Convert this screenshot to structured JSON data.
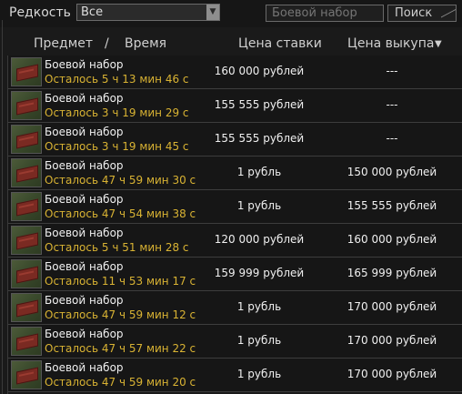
{
  "filter": {
    "rarity_label": "Редкость",
    "rarity_selected": "Все",
    "search_placeholder": "Боевой набор",
    "search_button_label": "Поиск"
  },
  "columns": {
    "item": "Предмет",
    "separator": "/",
    "time": "Время",
    "bid": "Цена ставки",
    "buyout": "Цена выкупа",
    "sort_icon": "▼"
  },
  "rows": [
    {
      "name": "Боевой набор",
      "time": "Осталось 5 ч 13 мин 46 с",
      "bid": "160 000 рублей",
      "buyout": "---"
    },
    {
      "name": "Боевой набор",
      "time": "Осталось 3 ч 19 мин 29 с",
      "bid": "155 555 рублей",
      "buyout": "---"
    },
    {
      "name": "Боевой набор",
      "time": "Осталось 3 ч 19 мин 45 с",
      "bid": "155 555 рублей",
      "buyout": "---"
    },
    {
      "name": "Боевой набор",
      "time": "Осталось 47 ч 59 мин 30 с",
      "bid": "1 рубль",
      "buyout": "150 000 рублей"
    },
    {
      "name": "Боевой набор",
      "time": "Осталось 47 ч 54 мин 38 с",
      "bid": "1 рубль",
      "buyout": "155 555 рублей"
    },
    {
      "name": "Боевой набор",
      "time": "Осталось 5 ч 51 мин 28 с",
      "bid": "120 000 рублей",
      "buyout": "160 000 рублей"
    },
    {
      "name": "Боевой набор",
      "time": "Осталось 11 ч 53 мин 17 с",
      "bid": "159 999 рублей",
      "buyout": "165 999 рублей"
    },
    {
      "name": "Боевой набор",
      "time": "Осталось 47 ч 59 мин 12 с",
      "bid": "1 рубль",
      "buyout": "170 000 рублей"
    },
    {
      "name": "Боевой набор",
      "time": "Осталось 47 ч 57 мин 22 с",
      "bid": "1 рубль",
      "buyout": "170 000 рублей"
    },
    {
      "name": "Боевой набор",
      "time": "Осталось 47 ч 59 мин 20 с",
      "bid": "1 рубль",
      "buyout": "170 000 рублей"
    }
  ],
  "colors": {
    "time_text": "#d9b333",
    "background": "#1a1a1a"
  }
}
